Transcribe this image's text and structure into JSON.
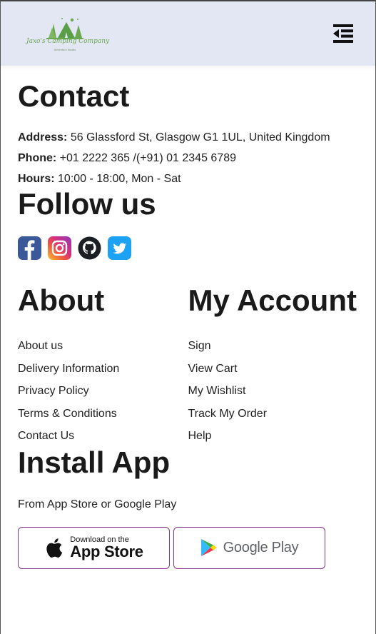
{
  "header": {
    "brand_name": "Jaxo's Camping Company",
    "brand_tagline": "Adventure Awaits",
    "menu_icon": "menu-collapse-icon"
  },
  "contact": {
    "title": "Contact",
    "address_label": "Address:",
    "address_value": "56 Glassford St, Glasgow G1 1UL, United Kingdom",
    "phone_label": "Phone:",
    "phone_value": "+01 2222 365 /(+91) 01 2345 6789",
    "hours_label": "Hours:",
    "hours_value": "10:00 - 18:00, Mon - Sat"
  },
  "follow": {
    "title": "Follow us",
    "icons": [
      "facebook-icon",
      "instagram-icon",
      "github-icon",
      "twitter-icon"
    ]
  },
  "about": {
    "title": "About",
    "links": [
      "About us",
      "Delivery Information",
      "Privacy Policy",
      "Terms & Conditions",
      "Contact Us"
    ]
  },
  "account": {
    "title": "My Account",
    "links": [
      "Sign",
      "View Cart",
      "My Wishlist",
      "Track My Order",
      "Help"
    ]
  },
  "install": {
    "title": "Install App",
    "subtitle": "From App Store or Google Play",
    "appstore_small": "Download on the",
    "appstore_big": "App Store",
    "googleplay": "Google Play"
  },
  "colors": {
    "header_bg": "#e3e6f3",
    "store_border": "#88338c",
    "logo_green": "#6aa84f"
  }
}
